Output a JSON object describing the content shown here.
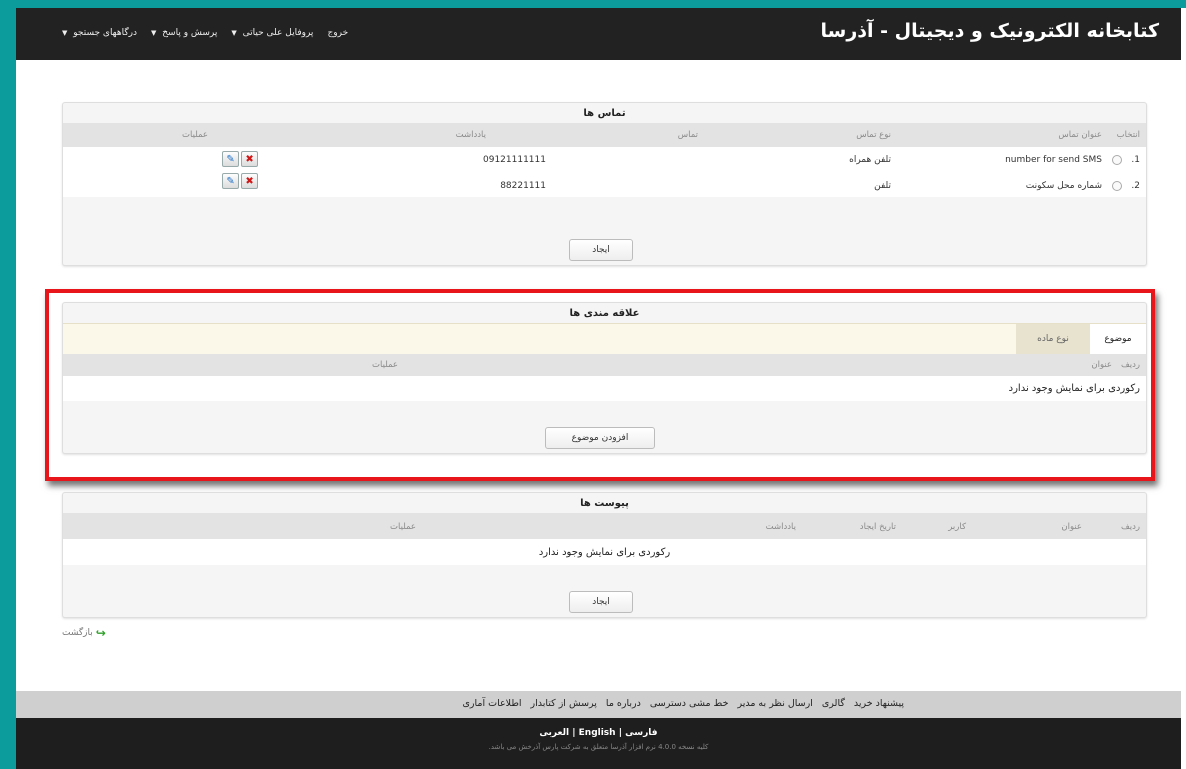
{
  "header": {
    "title": "کتابخانه الکترونیک و دیجیتال - آذرسا",
    "menu": [
      {
        "label": "درگاههای جستجو",
        "caret": true
      },
      {
        "label": "پرسش و پاسخ",
        "caret": true
      },
      {
        "label": "پروفایل علی حیاتی",
        "caret": true
      },
      {
        "label": "خروج",
        "caret": false
      }
    ]
  },
  "contacts": {
    "title": "تماس ها",
    "columns": {
      "select": "انتخاب",
      "contact_title": "عنوان تماس",
      "contact_type": "نوع تماس",
      "contact": "تماس",
      "note": "یادداشت",
      "operations": "عملیات"
    },
    "rows": [
      {
        "index": "1.",
        "title": "number for send SMS",
        "type": "تلفن همراه",
        "contact": "09121111111"
      },
      {
        "index": "2.",
        "title": "شماره محل سکونت",
        "type": "تلفن",
        "contact": "88221111"
      }
    ],
    "create_label": "ایجاد"
  },
  "interests": {
    "title": "علاقه مندی ها",
    "tabs": [
      {
        "label": "موضوع",
        "active": true
      },
      {
        "label": "نوع ماده",
        "active": false
      }
    ],
    "columns": {
      "row": "ردیف",
      "title": "عنوان",
      "operations": "عملیات"
    },
    "empty_message": "رکوردی برای نمایش وجود ندارد",
    "add_label": "افزودن موضوع"
  },
  "attachments": {
    "title": "پیوست ها",
    "columns": {
      "row": "ردیف",
      "title": "عنوان",
      "user": "کاربر",
      "created_date": "تاریخ ایجاد",
      "note": "یادداشت",
      "operations": "عملیات"
    },
    "empty_message": "رکوردی برای نمایش وجود ندارد",
    "create_label": "ایجاد"
  },
  "back_label": "بازگشت",
  "footer": {
    "links": [
      "پیشنهاد خرید",
      "گالری",
      "ارسال نظر به مدیر",
      "خط مشی دسترسی",
      "درباره ما",
      "پرسش از کتابدار",
      "اطلاعات آماری"
    ],
    "lang_fa": "فارسی",
    "lang_en": "English",
    "lang_ar": "العربی",
    "sep": "|",
    "copyright": "کلیه نسخه 4.0.0 نرم افزار آذرسا متعلق به شرکت پارس آذرخش می باشد."
  },
  "colors": {
    "accent_frame": "#0c9c9b",
    "highlight": "#e8161a",
    "header_bg": "#222222"
  }
}
